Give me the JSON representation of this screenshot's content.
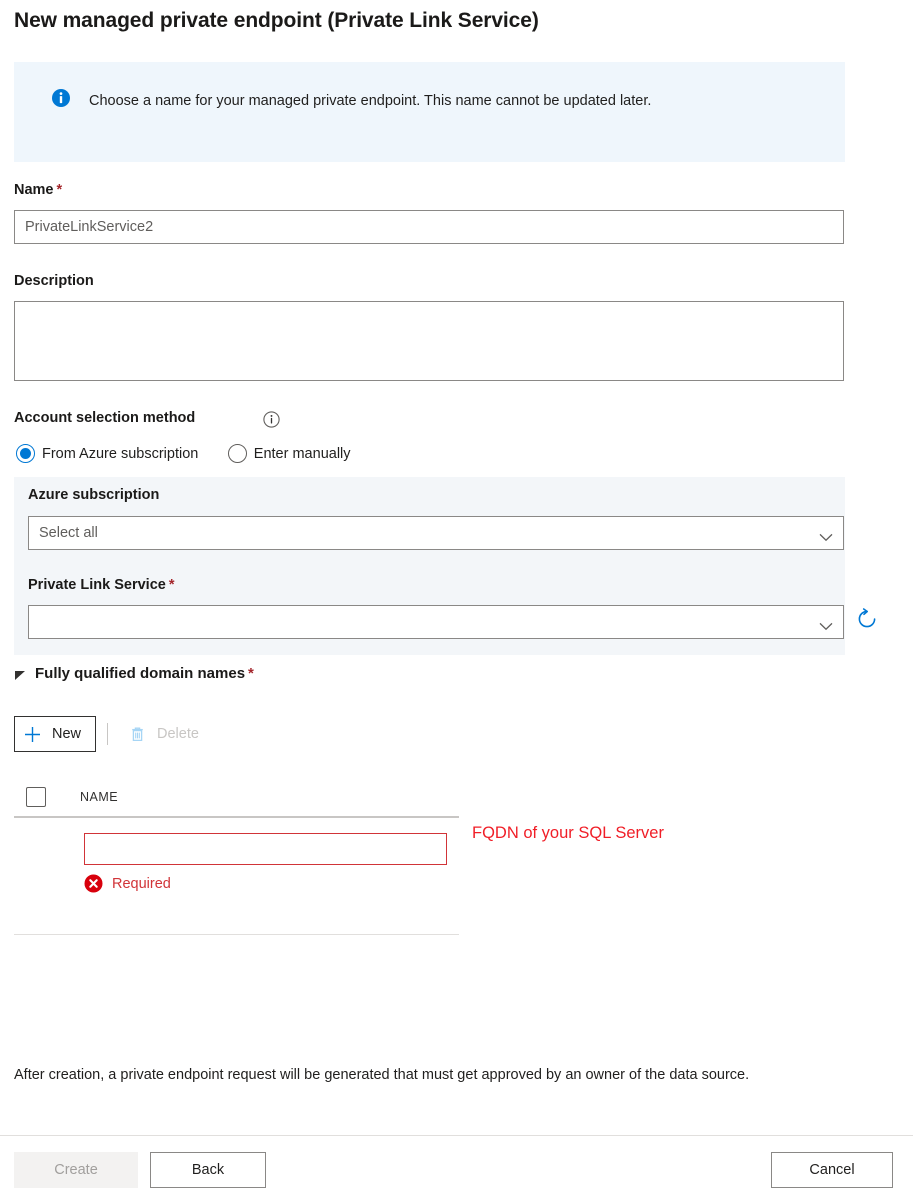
{
  "page": {
    "title": "New managed private endpoint (Private Link Service)"
  },
  "info_banner": {
    "icon": "info-icon",
    "text": "Choose a name for your managed private endpoint. This name cannot be updated later."
  },
  "form": {
    "name": {
      "label": "Name",
      "required_marker": "*",
      "value": "PrivateLinkService2"
    },
    "description": {
      "label": "Description",
      "value": ""
    },
    "account_selection_method": {
      "label": "Account selection method",
      "info_icon": "info-circle-icon",
      "options": [
        {
          "label": "From Azure subscription",
          "selected": true
        },
        {
          "label": "Enter manually",
          "selected": false
        }
      ]
    },
    "azure_subscription": {
      "label": "Azure subscription",
      "value": "Select all",
      "chevron_icon": "chevron-down-icon"
    },
    "private_link_service": {
      "label": "Private Link Service",
      "required_marker": "*",
      "value": "",
      "chevron_icon": "chevron-down-icon",
      "refresh_icon": "refresh-icon"
    }
  },
  "fqdn_section": {
    "title": "Fully qualified domain names",
    "required_marker": "*",
    "expand_icon": "triangle-expanded-icon",
    "toolbar": {
      "new_label": "New",
      "new_icon": "plus-icon",
      "delete_label": "Delete",
      "delete_icon": "trash-icon",
      "delete_disabled": true
    },
    "grid": {
      "columns": [
        "NAME"
      ],
      "select_all_checkbox": "checkbox-unchecked",
      "rows": [
        {
          "name_value": "",
          "error_icon": "error-circle-icon",
          "error_text": "Required"
        }
      ]
    }
  },
  "annotation": {
    "text": "FQDN of your SQL Server",
    "color": "#f01e27"
  },
  "footer": {
    "note": "After creation, a private endpoint request will be generated that must get approved by an owner of the data source.",
    "buttons": {
      "create": "Create",
      "back": "Back",
      "cancel": "Cancel"
    }
  },
  "colors": {
    "accent": "#0078d4",
    "banner_bg": "#eff6fc",
    "panel_bg": "#f3f6f9",
    "error": "#d13438",
    "required_star": "#a4262c"
  }
}
